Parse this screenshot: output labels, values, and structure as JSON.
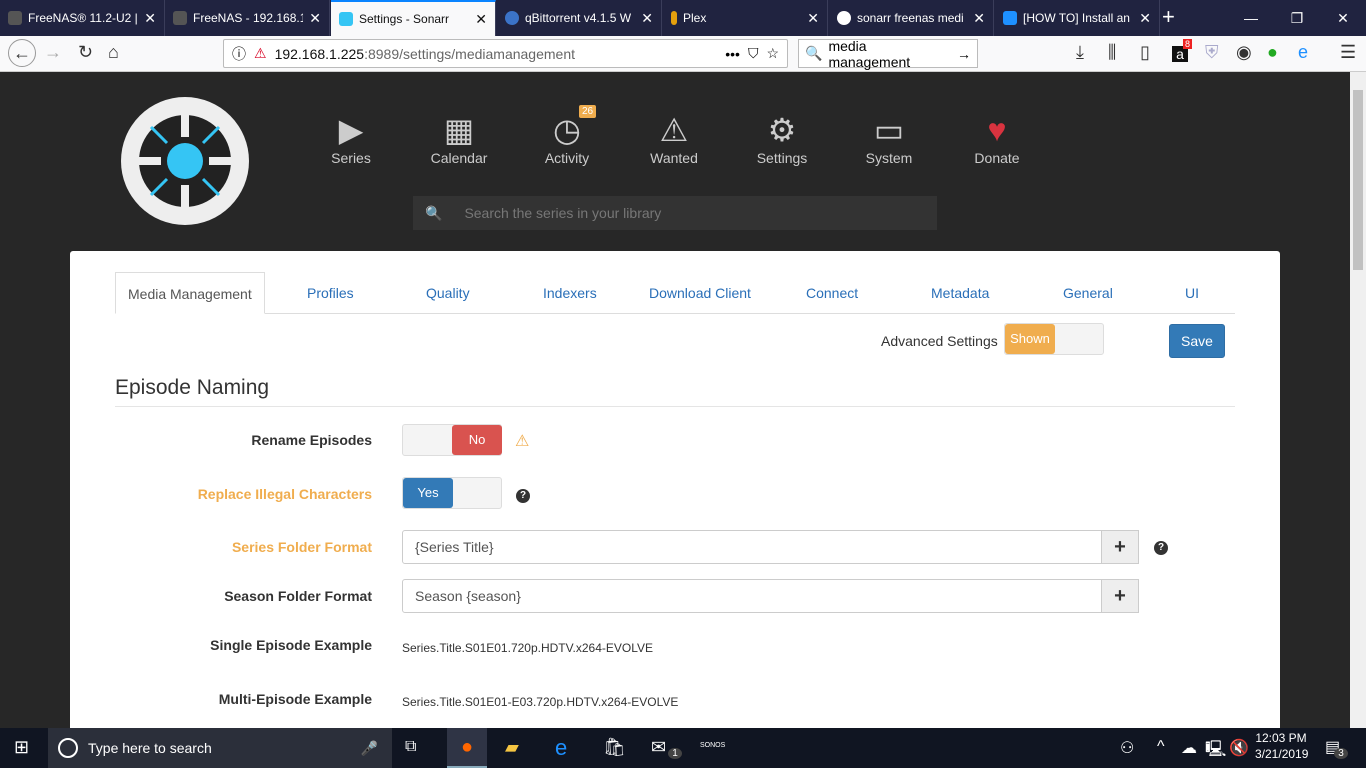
{
  "browser": {
    "tabs": [
      {
        "title": "FreeNAS® 11.2-U2 |",
        "color": "#555"
      },
      {
        "title": "FreeNAS - 192.168.1",
        "color": "#555"
      },
      {
        "title": "Settings - Sonarr",
        "color": "#35c5f4",
        "active": true
      },
      {
        "title": "qBittorrent v4.1.5 W",
        "color": "#3b73c8"
      },
      {
        "title": "Plex",
        "color": "#e5a00d"
      },
      {
        "title": "sonarr freenas medi",
        "color": "#4285f4"
      },
      {
        "title": "[HOW TO] Install an",
        "color": "#1e90ff"
      }
    ],
    "new_tab": "+",
    "url_host": "192.168.1.225",
    "url_path": ":8989/settings/mediamanagement",
    "search_value": "media management",
    "badge_count": "8"
  },
  "app": {
    "nav": [
      {
        "label": "Series",
        "icon": "▶"
      },
      {
        "label": "Calendar",
        "icon": "📅"
      },
      {
        "label": "Activity",
        "icon": "◷",
        "badge": "26"
      },
      {
        "label": "Wanted",
        "icon": "⚠"
      },
      {
        "label": "Settings",
        "icon": "⚙"
      },
      {
        "label": "System",
        "icon": "💻"
      },
      {
        "label": "Donate",
        "icon": "♥"
      }
    ],
    "search_placeholder": "Search the series in your library",
    "tabs": [
      "Media Management",
      "Profiles",
      "Quality",
      "Indexers",
      "Download Client",
      "Connect",
      "Metadata",
      "General",
      "UI"
    ],
    "advanced_label": "Advanced Settings",
    "advanced_state": "Shown",
    "save": "Save",
    "section_title": "Episode Naming",
    "rename_label": "Rename Episodes",
    "rename_value": "No",
    "illegal_label": "Replace Illegal Characters",
    "illegal_value": "Yes",
    "series_folder_label": "Series Folder Format",
    "series_folder_value": "{Series Title}",
    "season_folder_label": "Season Folder Format",
    "season_folder_value": "Season {season}",
    "single_label": "Single Episode Example",
    "single_value": "Series.Title.S01E01.720p.HDTV.x264-EVOLVE",
    "multi_label": "Multi-Episode Example",
    "multi_value": "Series.Title.S01E01-E03.720p.HDTV.x264-EVOLVE"
  },
  "taskbar": {
    "search": "Type here to search",
    "time": "12:03 PM",
    "date": "3/21/2019",
    "mail_badge": "1",
    "notif_badge": "3",
    "sonos": "SONOS"
  }
}
